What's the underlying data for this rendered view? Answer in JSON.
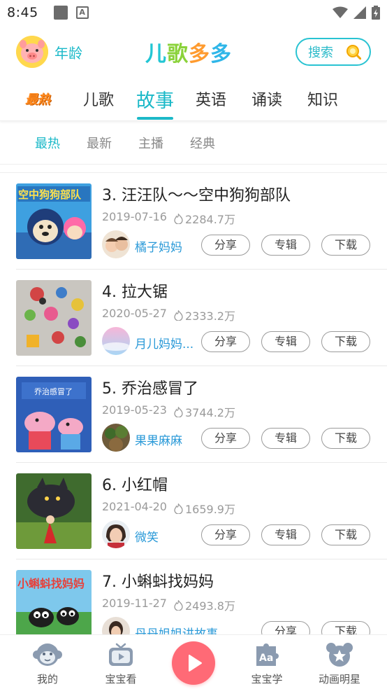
{
  "status_bar": {
    "time": "8:45"
  },
  "header": {
    "age_label": "年龄",
    "logo_chars": [
      "儿",
      "歌",
      "多",
      "多"
    ],
    "search_label": "搜索"
  },
  "top_tabs": [
    {
      "label": "最热"
    },
    {
      "label": "儿歌"
    },
    {
      "label": "故事",
      "active": true
    },
    {
      "label": "英语"
    },
    {
      "label": "诵读"
    },
    {
      "label": "知识"
    }
  ],
  "sub_tabs": [
    {
      "label": "最热",
      "active": true
    },
    {
      "label": "最新"
    },
    {
      "label": "主播"
    },
    {
      "label": "经典"
    }
  ],
  "stories": [
    {
      "title": "3. 汪汪队～～空中狗狗部队",
      "date": "2019-07-16",
      "plays": "2284.7万",
      "author": "橘子妈妈",
      "thumb_text": "空中狗狗部队"
    },
    {
      "title": "4. 拉大锯",
      "date": "2020-05-27",
      "plays": "2333.2万",
      "author": "月儿妈妈..."
    },
    {
      "title": "5. 乔治感冒了",
      "date": "2019-05-23",
      "plays": "3744.2万",
      "author": "果果麻麻",
      "thumb_text": "乔治感冒了"
    },
    {
      "title": "6. 小红帽",
      "date": "2021-04-20",
      "plays": "1659.9万",
      "author": "微笑"
    },
    {
      "title": "7. 小蝌蚪找妈妈",
      "date": "2019-11-27",
      "plays": "2493.8万",
      "author": "丹丹姐姐讲故事",
      "thumb_text": "小蝌蚪找妈妈"
    }
  ],
  "actions": {
    "share": "分享",
    "album": "专辑",
    "download": "下载"
  },
  "bottom_nav": [
    {
      "label": "我的",
      "icon": "monkey-face-icon"
    },
    {
      "label": "宝宝看",
      "icon": "tv-play-icon"
    },
    {
      "label": "",
      "icon": "play-icon"
    },
    {
      "label": "宝宝学",
      "icon": "puzzle-aa-icon"
    },
    {
      "label": "动画明星",
      "icon": "bear-star-icon"
    }
  ],
  "colors": {
    "accent": "#1cb9c8",
    "author": "#2b9ad8",
    "play_button": "#ff6a76",
    "hot": "#ff8a1f"
  }
}
